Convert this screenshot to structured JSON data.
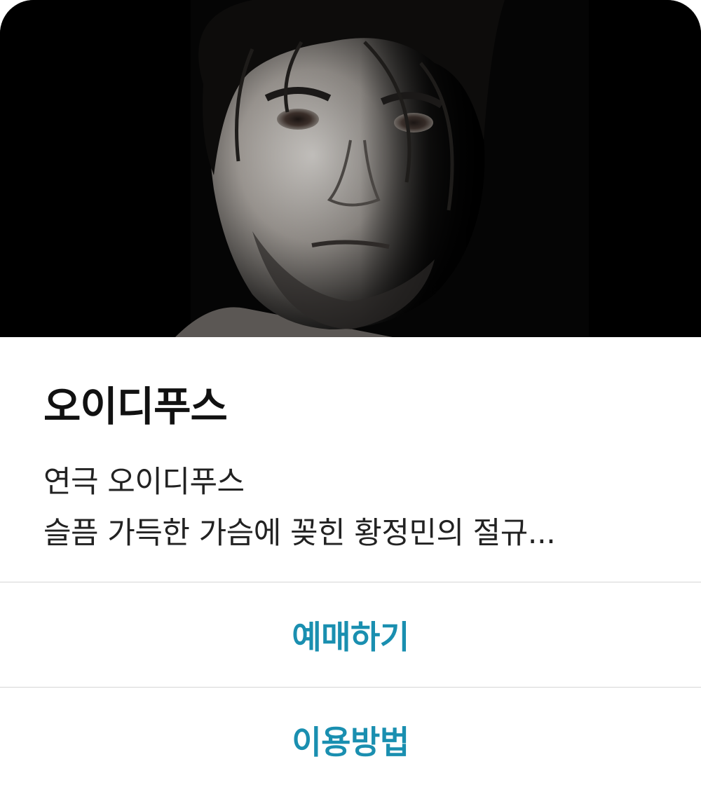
{
  "card": {
    "title": "오이디푸스",
    "description_line1": "연극 오이디푸스",
    "description_line2": "슬픔 가득한 가슴에 꽂힌 황정민의 절규...",
    "image_alt": "오이디푸스 포스터"
  },
  "actions": {
    "reserve_label": "예매하기",
    "howto_label": "이용방법"
  },
  "colors": {
    "accent": "#1a8fb0",
    "title": "#111111",
    "divider": "#d6d6d6"
  }
}
